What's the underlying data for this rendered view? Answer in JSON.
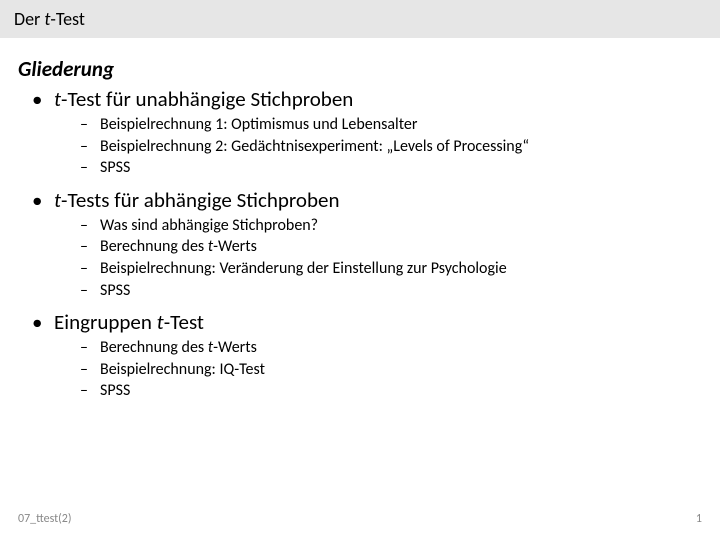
{
  "title": {
    "prefix": "Der ",
    "italic": "t",
    "suffix": "-Test"
  },
  "heading": "Gliederung",
  "sections": [
    {
      "label": {
        "italic": "t",
        "rest": "-Test für unabhängige Stichproben"
      },
      "items": [
        {
          "text": "Beispielrechnung 1: Optimismus und Lebensalter"
        },
        {
          "text": "Beispielrechnung 2: Gedächtnisexperiment: „Levels of Processing“"
        },
        {
          "text": "SPSS"
        }
      ]
    },
    {
      "label": {
        "italic": "t",
        "rest": "-Tests für abhängige Stichproben"
      },
      "items": [
        {
          "text": "Was sind abhängige Stichproben?"
        },
        {
          "pre": "Berechnung des ",
          "italic": "t",
          "post": "-Werts"
        },
        {
          "text": "Beispielrechnung: Veränderung der Einstellung zur Psychologie"
        },
        {
          "text": "SPSS"
        }
      ]
    },
    {
      "label": {
        "pre": "Eingruppen ",
        "italic": "t",
        "rest": "-Test"
      },
      "items": [
        {
          "pre": "Berechnung des ",
          "italic": "t",
          "post": "-Werts"
        },
        {
          "text": "Beispielrechnung: IQ-Test"
        },
        {
          "text": "SPSS"
        }
      ]
    }
  ],
  "footer": {
    "left": "07_ttest(2)",
    "right": "1"
  },
  "glyphs": {
    "bullet": "•",
    "dash": "–"
  }
}
